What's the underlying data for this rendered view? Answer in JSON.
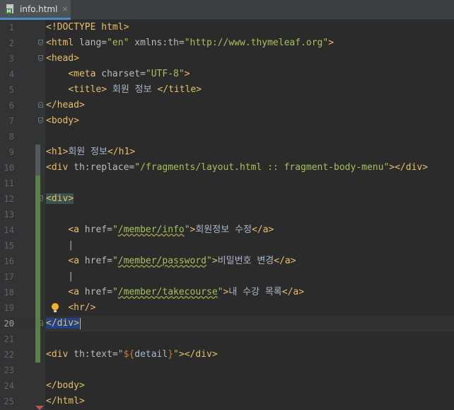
{
  "tab": {
    "filename": "info.html",
    "close_glyph": "×"
  },
  "colors": {
    "background": "#2b2b2b",
    "gutter": "#313335",
    "tag": "#e8bf6a",
    "string": "#a5c25c",
    "change_marker": "#5b7f48"
  },
  "current_line": 20,
  "code_lines": [
    {
      "n": "1",
      "t": "<!DOCTYPE html>"
    },
    {
      "n": "2",
      "t": "<html lang=\"en\" xmlns:th=\"http://www.thymeleaf.org\">"
    },
    {
      "n": "3",
      "t": "<head>"
    },
    {
      "n": "4",
      "t": "    <meta charset=\"UTF-8\">"
    },
    {
      "n": "5",
      "t": "    <title> 회원 정보 </title>"
    },
    {
      "n": "6",
      "t": "</head>"
    },
    {
      "n": "7",
      "t": "<body>"
    },
    {
      "n": "8",
      "t": ""
    },
    {
      "n": "9",
      "t": "<h1>회원 정보</h1>"
    },
    {
      "n": "10",
      "t": "<div th:replace=\"/fragments/layout.html :: fragment-body-menu\"></div>"
    },
    {
      "n": "11",
      "t": ""
    },
    {
      "n": "12",
      "t": "<div>"
    },
    {
      "n": "13",
      "t": ""
    },
    {
      "n": "14",
      "t": "    <a href=\"/member/info\">회원정보 수정</a>"
    },
    {
      "n": "15",
      "t": "    |"
    },
    {
      "n": "16",
      "t": "    <a href=\"/member/password\">비밀번호 변경</a>"
    },
    {
      "n": "17",
      "t": "    |"
    },
    {
      "n": "18",
      "t": "    <a href=\"/member/takecourse\">내 수강 목록</a>"
    },
    {
      "n": "19",
      "t": "    <hr/>"
    },
    {
      "n": "20",
      "t": "</div>"
    },
    {
      "n": "21",
      "t": ""
    },
    {
      "n": "22",
      "t": "<div th:text=\"${detail}\"></div>"
    },
    {
      "n": "23",
      "t": ""
    },
    {
      "n": "24",
      "t": "</body>"
    },
    {
      "n": "25",
      "t": "</html>"
    }
  ]
}
